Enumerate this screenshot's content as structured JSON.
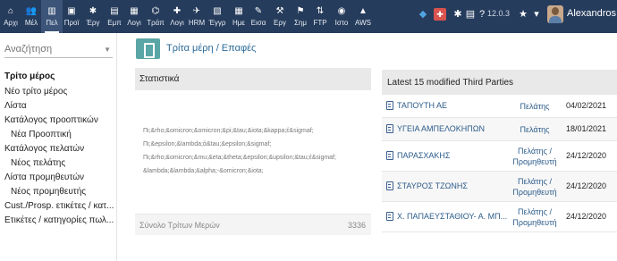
{
  "topbar": {
    "items": [
      {
        "label": "Αρχι",
        "icon": "home-icon",
        "glyph": "⌂"
      },
      {
        "label": "Μέλ",
        "icon": "members-icon",
        "glyph": "👥"
      },
      {
        "label": "Πελ",
        "icon": "third-party-icon",
        "glyph": "▥",
        "active": true
      },
      {
        "label": "Προϊ",
        "icon": "products-icon",
        "glyph": "▣"
      },
      {
        "label": "Έργ",
        "icon": "projects-icon",
        "glyph": "✱"
      },
      {
        "label": "Εμπ",
        "icon": "commercial-icon",
        "glyph": "▤"
      },
      {
        "label": "Λογι",
        "icon": "billing-icon",
        "glyph": "▦"
      },
      {
        "label": "Τράπ",
        "icon": "bank-icon",
        "glyph": "⌬"
      },
      {
        "label": "Λογι",
        "icon": "accounting-icon",
        "glyph": "✚"
      },
      {
        "label": "HRM",
        "icon": "hrm-icon",
        "glyph": "✈"
      },
      {
        "label": "Έγγρ",
        "icon": "documents-icon",
        "glyph": "▧"
      },
      {
        "label": "Ημε",
        "icon": "agenda-icon",
        "glyph": "▦"
      },
      {
        "label": "Εισα",
        "icon": "tickets-icon",
        "glyph": "✎"
      },
      {
        "label": "Εργ",
        "icon": "tools-icon",
        "glyph": "⚒"
      },
      {
        "label": "Σημ",
        "icon": "flag-icon",
        "glyph": "⚑"
      },
      {
        "label": "FTP",
        "icon": "ftp-icon",
        "glyph": "⇅"
      },
      {
        "label": "Ιστο",
        "icon": "website-icon",
        "glyph": "◉"
      },
      {
        "label": "AWS",
        "icon": "aws-icon",
        "glyph": "▲"
      }
    ],
    "version": "12.0.3",
    "username": "Alexandros"
  },
  "leftmenu": {
    "search_placeholder": "Αναζήτηση",
    "items": [
      {
        "label": "Τρίτο μέρος",
        "kind": "title"
      },
      {
        "label": "Νέο τρίτο μέρος",
        "kind": "item"
      },
      {
        "label": "Λίστα",
        "kind": "item"
      },
      {
        "label": "Κατάλογος προοπτικών",
        "kind": "item"
      },
      {
        "label": "Νέα Προοπτική",
        "kind": "sub"
      },
      {
        "label": "Κατάλογος πελατών",
        "kind": "item"
      },
      {
        "label": "Νέος πελάτης",
        "kind": "sub"
      },
      {
        "label": "Λίστα προμηθευτών",
        "kind": "item"
      },
      {
        "label": "Νέος προμηθευτής",
        "kind": "sub"
      },
      {
        "label": "Cust./Prosp. ετικέτες / κατ...",
        "kind": "item"
      },
      {
        "label": "Ετικέτες / κατηγορίες πωλ...",
        "kind": "item"
      }
    ]
  },
  "page": {
    "title": "Τρίτα μέρη / Επαφές"
  },
  "stats": {
    "title": "Στατιστικά",
    "entity_lines": [
      "Πι;&rho;&omicron;&omicron;&pi;&tau;&iota;&kappa;έ&sigmaf;",
      "Πι;&epsilon;&lambda;ά&tau;&epsilon;&sigmaf;",
      "Πι;&rho;&omicron;&mu;&eta;&theta;&epsilon;&upsilon;&tau;έ&sigmaf;",
      "&lambda;&lambda;&alpha;-&omicron;&iota;"
    ],
    "total_label": "Σύνολο Τρίτων Μερών",
    "total_value": "3336"
  },
  "latest": {
    "title": "Latest 15 modified Third Parties",
    "rows": [
      {
        "name": "ΤΑΠΟΥΤΗ ΑΕ",
        "type": "Πελάτης",
        "date": "04/02/2021"
      },
      {
        "name": "ΥΓΕΙΑ ΑΜΠΕΛΟΚΗΠΩΝ",
        "type": "Πελάτης",
        "date": "18/01/2021"
      },
      {
        "name": "ΠΑΡΑΣΧΑΚΗΣ",
        "type": "Πελάτης / Προμηθευτή",
        "date": "24/12/2020"
      },
      {
        "name": "ΣΤΑΥΡΟΣ ΤΖΩΝΗΣ",
        "type": "Πελάτης / Προμηθευτή",
        "date": "24/12/2020"
      },
      {
        "name": "Χ. ΠΑΠΑΕΥΣΤΑΘΙΟΥ- Α. ΜΠ...",
        "type": "Πελάτης / Προμηθευτή",
        "date": "24/12/2020"
      }
    ]
  }
}
